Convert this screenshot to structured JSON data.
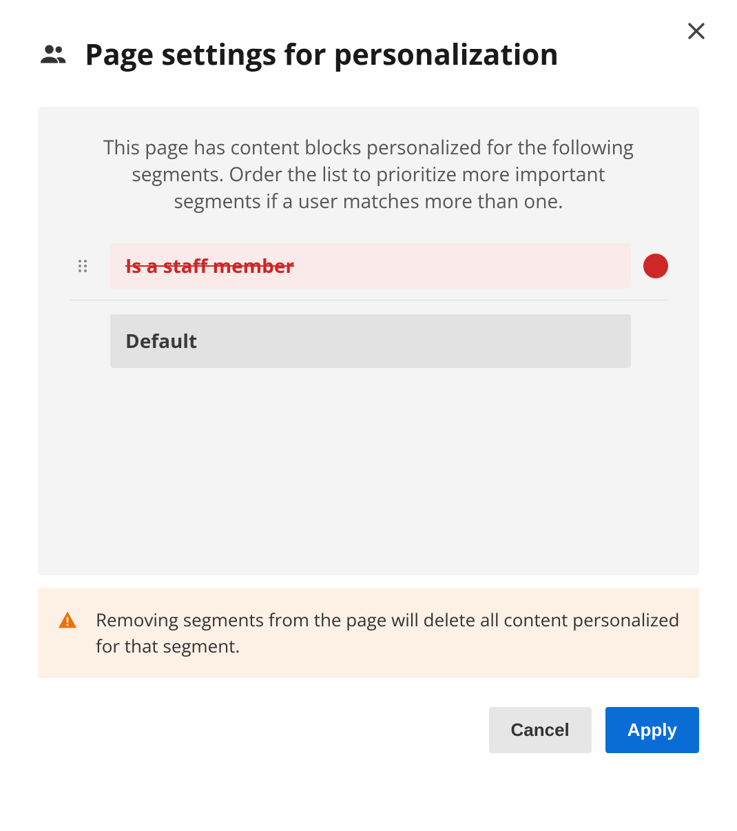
{
  "header": {
    "title": "Page settings for personalization"
  },
  "panel": {
    "intro": "This page has content blocks personalized for the following segments. Order the list to prioritize more important segments if a user matches more than one.",
    "segments": [
      {
        "label": "Is a staff member",
        "removed": true
      }
    ],
    "default_label": "Default"
  },
  "alert": {
    "text": "Removing segments from the page will delete all content personalized for that segment."
  },
  "footer": {
    "cancel_label": "Cancel",
    "apply_label": "Apply"
  }
}
